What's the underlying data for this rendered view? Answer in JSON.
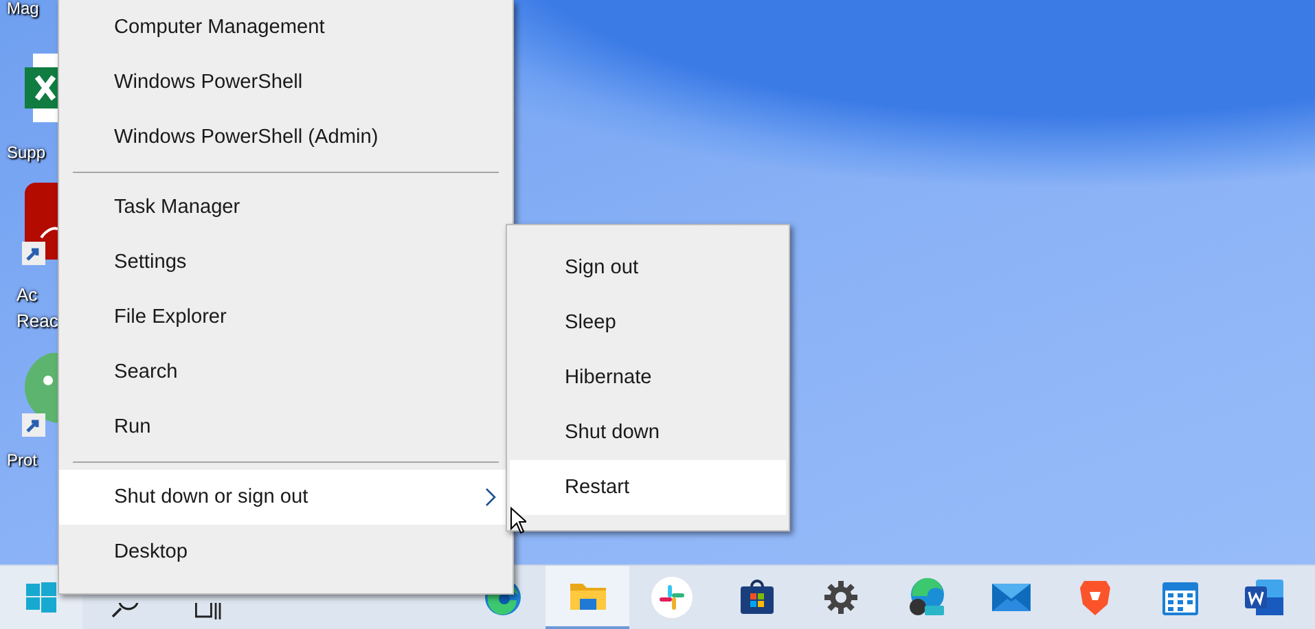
{
  "desktop_icons": [
    {
      "kind": "label",
      "lines": [
        "Mag"
      ]
    },
    {
      "kind": "excel",
      "lines": [
        "Supp"
      ]
    },
    {
      "kind": "acrobat",
      "lines": [
        "Ac",
        "Reac"
      ]
    },
    {
      "kind": "proton",
      "lines": [
        "Prot"
      ]
    }
  ],
  "main_menu": {
    "items": [
      {
        "kind": "item",
        "label": "Computer Management",
        "selected": false,
        "has_submenu": false
      },
      {
        "kind": "item",
        "label": "Windows PowerShell",
        "selected": false,
        "has_submenu": false
      },
      {
        "kind": "item",
        "label": "Windows PowerShell (Admin)",
        "selected": false,
        "has_submenu": false
      },
      {
        "kind": "separator"
      },
      {
        "kind": "item",
        "label": "Task Manager",
        "selected": false,
        "has_submenu": false
      },
      {
        "kind": "item",
        "label": "Settings",
        "selected": false,
        "has_submenu": false
      },
      {
        "kind": "item",
        "label": "File Explorer",
        "selected": false,
        "has_submenu": false
      },
      {
        "kind": "item",
        "label": "Search",
        "selected": false,
        "has_submenu": false
      },
      {
        "kind": "item",
        "label": "Run",
        "selected": false,
        "has_submenu": false
      },
      {
        "kind": "separator"
      },
      {
        "kind": "item",
        "label": "Shut down or sign out",
        "selected": true,
        "has_submenu": true
      },
      {
        "kind": "item",
        "label": "Desktop",
        "selected": false,
        "has_submenu": false
      }
    ]
  },
  "submenu": {
    "items": [
      {
        "label": "Sign out",
        "selected": false
      },
      {
        "label": "Sleep",
        "selected": false
      },
      {
        "label": "Hibernate",
        "selected": false
      },
      {
        "label": "Shut down",
        "selected": false
      },
      {
        "label": "Restart",
        "selected": true
      }
    ]
  },
  "taskbar": {
    "items": [
      {
        "kind": "start",
        "active": false
      },
      {
        "kind": "search",
        "active": false
      },
      {
        "kind": "taskview",
        "active": false
      },
      {
        "kind": "spacer"
      },
      {
        "kind": "edge",
        "active": false
      },
      {
        "kind": "folder",
        "active": true
      },
      {
        "kind": "slack",
        "active": false
      },
      {
        "kind": "store",
        "active": false
      },
      {
        "kind": "gear",
        "active": false
      },
      {
        "kind": "edgebeta",
        "active": false
      },
      {
        "kind": "mail",
        "active": false
      },
      {
        "kind": "brave",
        "active": false
      },
      {
        "kind": "calendar",
        "active": false
      },
      {
        "kind": "word",
        "active": false
      }
    ]
  }
}
